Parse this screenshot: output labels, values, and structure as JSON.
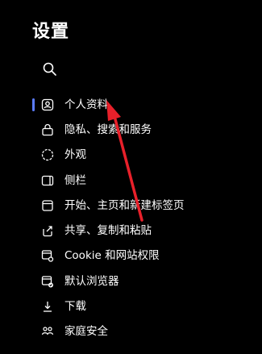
{
  "page": {
    "title": "设置"
  },
  "search": {
    "icon": "search-icon"
  },
  "nav": {
    "items": [
      {
        "label": "个人资料",
        "icon": "profile-icon",
        "active": true
      },
      {
        "label": "隐私、搜索和服务",
        "icon": "lock-icon"
      },
      {
        "label": "外观",
        "icon": "appearance-icon"
      },
      {
        "label": "侧栏",
        "icon": "sidebar-icon"
      },
      {
        "label": "开始、主页和新建标签页",
        "icon": "home-icon"
      },
      {
        "label": "共享、复制和粘贴",
        "icon": "share-icon"
      },
      {
        "label": "Cookie 和网站权限",
        "icon": "site-permissions-icon"
      },
      {
        "label": "默认浏览器",
        "icon": "default-browser-icon"
      },
      {
        "label": "下载",
        "icon": "download-icon"
      },
      {
        "label": "家庭安全",
        "icon": "family-icon"
      }
    ]
  },
  "colors": {
    "background": "#000000",
    "text": "#ffffff",
    "accent": "#5b7cff",
    "annotation_arrow": "#e8202a"
  }
}
